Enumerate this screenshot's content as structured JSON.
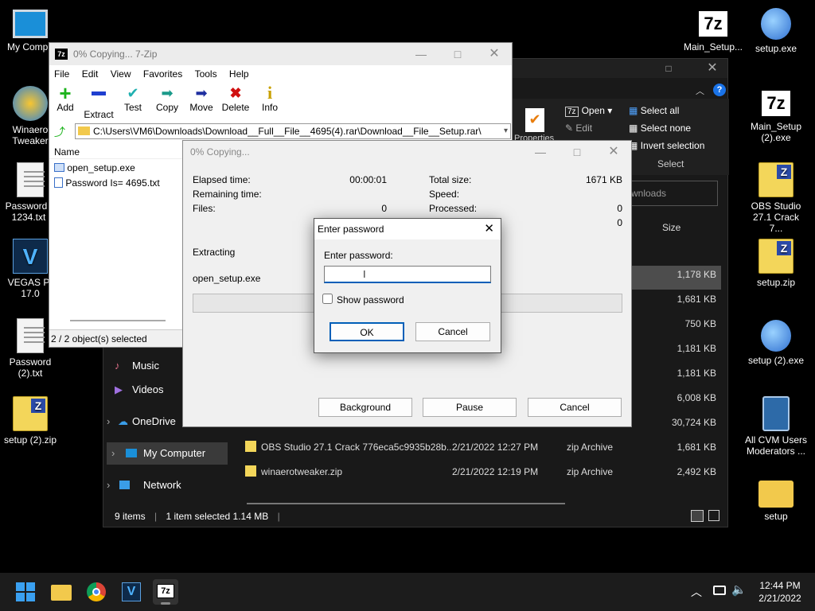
{
  "desktop_icons": [
    {
      "label": "My Compu"
    },
    {
      "label": "Winaero Tweaker"
    },
    {
      "label": "Password i 1234.txt"
    },
    {
      "label": "VEGAS Pr 17.0"
    },
    {
      "label": "Password (2).txt"
    },
    {
      "label": "setup (2).zip"
    },
    {
      "label": "Main_Setup..."
    },
    {
      "label": "setup.exe"
    },
    {
      "label": "Main_Setup (2).exe"
    },
    {
      "label": "OBS Studio 27.1 Crack 7..."
    },
    {
      "label": "setup.zip"
    },
    {
      "label": "setup (2).exe"
    },
    {
      "label": "All CVM Users Moderators ..."
    },
    {
      "label": "setup"
    }
  ],
  "explorer": {
    "ribbon": {
      "open": "Open",
      "edit": "Edit",
      "properties": "Properties",
      "select_all": "Select all",
      "select_none": "Select none",
      "invert_selection": "Invert selection",
      "group_label": "Select"
    },
    "search_placeholder": "wnloads",
    "size_header": "Size",
    "nav": [
      "Music",
      "Videos",
      "OneDrive",
      "My Computer",
      "Network"
    ],
    "size_column": [
      "1,178 KB",
      "1,681 KB",
      "750 KB",
      "1,181 KB",
      "1,181 KB",
      "6,008 KB",
      "30,724 KB"
    ],
    "rows": [
      {
        "name": "OBS Studio 27.1 Crack 776eca5c9935b28b...",
        "date": "2/21/2022 12:27 PM",
        "type": "zip Archive",
        "size": "1,681 KB"
      },
      {
        "name": "winaerotweaker.zip",
        "date": "2/21/2022 12:19 PM",
        "type": "zip Archive",
        "size": "2,492 KB"
      }
    ],
    "status": {
      "items": "9 items",
      "selected": "1 item selected  1.14 MB"
    }
  },
  "zip_window": {
    "title": "0% Copying... 7-Zip",
    "menu": [
      "File",
      "Edit",
      "View",
      "Favorites",
      "Tools",
      "Help"
    ],
    "toolbar": [
      "Add",
      "Extract",
      "Test",
      "Copy",
      "Move",
      "Delete",
      "Info"
    ],
    "address": "C:\\Users\\VM6\\Downloads\\Download__Full__File__4695(4).rar\\Download__File__Setup.rar\\",
    "column_name": "Name",
    "files": [
      "open_setup.exe",
      "Password Is= 4695.txt"
    ],
    "status": "2 / 2 object(s) selected"
  },
  "progress_window": {
    "title": "0% Copying...",
    "elapsed_label": "Elapsed time:",
    "elapsed_value": "00:00:01",
    "remaining_label": "Remaining time:",
    "files_label": "Files:",
    "files_value": "0",
    "total_label": "Total size:",
    "total_value": "1671 KB",
    "speed_label": "Speed:",
    "processed_label": "Processed:",
    "processed_value": "0",
    "extra_value": "0",
    "extracting": "Extracting",
    "current_file": "open_setup.exe",
    "progress": 0,
    "buttons": [
      "Background",
      "Pause",
      "Cancel"
    ]
  },
  "password_dialog": {
    "title": "Enter password",
    "prompt": "Enter password:",
    "value": "",
    "show_password": "Show password",
    "ok": "OK",
    "cancel": "Cancel"
  },
  "taskbar": {
    "time": "12:44 PM",
    "date": "2/21/2022",
    "zip_icon": "7z",
    "vegas_icon": "V"
  },
  "colors": {
    "accent": "#005fb8",
    "desktop": "#000000"
  }
}
